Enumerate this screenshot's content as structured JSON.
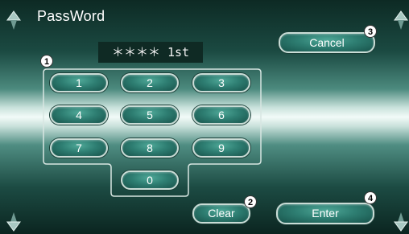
{
  "screen": {
    "title": "PassWord",
    "password_display": "＊＊＊＊ 1st"
  },
  "keypad": {
    "keys": [
      "1",
      "2",
      "3",
      "4",
      "5",
      "6",
      "7",
      "8",
      "9",
      "0"
    ]
  },
  "buttons": {
    "cancel": "Cancel",
    "clear": "Clear",
    "enter": "Enter"
  },
  "callouts": {
    "keypad": "1",
    "clear": "2",
    "cancel": "3",
    "enter": "4"
  },
  "icons": {
    "top_left": "up-arrow-icon",
    "top_right": "up-arrow-icon",
    "bottom_left": "down-arrow-icon",
    "bottom_right": "down-arrow-icon"
  }
}
